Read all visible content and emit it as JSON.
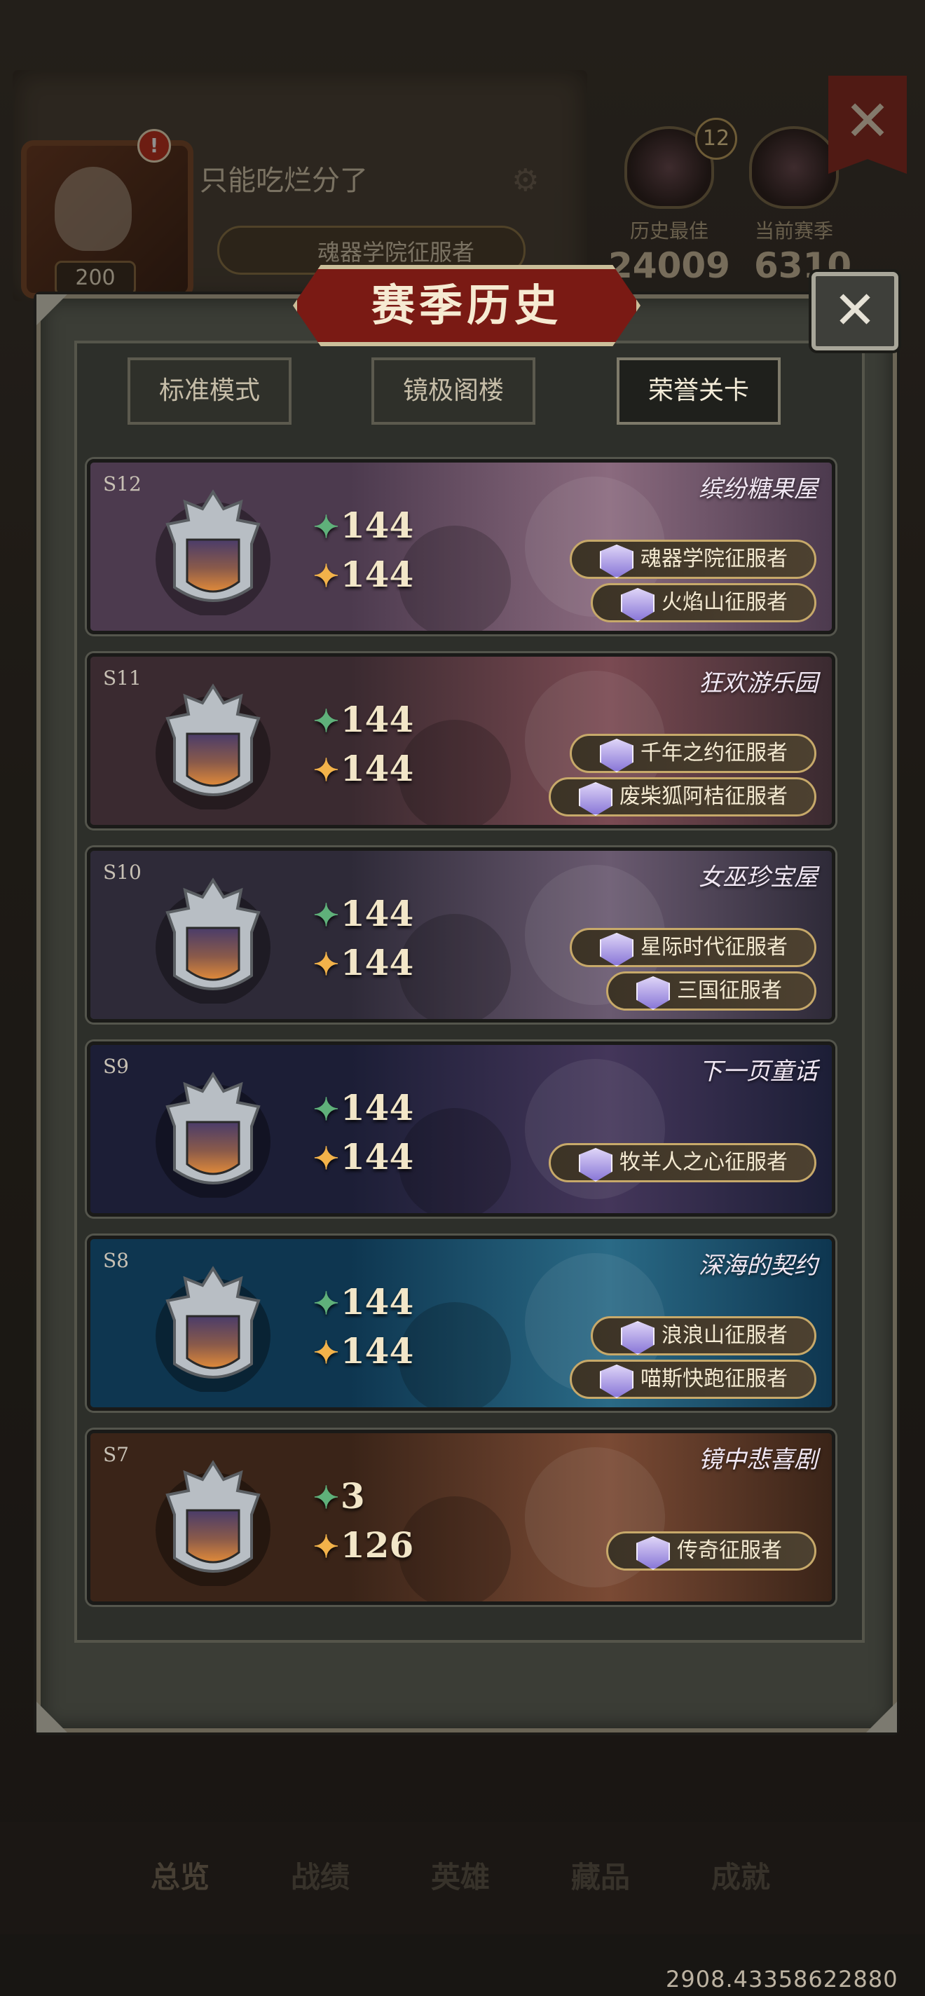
{
  "profile": {
    "player_name": "只能吃烂分了",
    "level": "200",
    "alert_badge": "!",
    "title_badge": "魂器学院征服者",
    "best_label": "历史最佳",
    "current_label": "当前赛季",
    "best_score": "24009",
    "current_score": "6310",
    "rank_badge": "12",
    "close_symbol": "✕"
  },
  "bottom_tabs": [
    "总览",
    "战绩",
    "英雄",
    "藏品",
    "成就"
  ],
  "coord_readout": "2908.43358622880",
  "modal": {
    "title": "赛季历史",
    "close_symbol": "✕",
    "tabs": [
      "标准模式",
      "镜极阁楼",
      "荣誉关卡"
    ],
    "active_tab": "荣誉关卡"
  },
  "seasons": [
    {
      "id": "S12",
      "name": "缤纷糖果屋",
      "green": "144",
      "gold": "144",
      "conquests": [
        "魂器学院征服者",
        "火焰山征服者"
      ],
      "colors": [
        "#4c3a4e",
        "#8a6a7e"
      ]
    },
    {
      "id": "S11",
      "name": "狂欢游乐园",
      "green": "144",
      "gold": "144",
      "conquests": [
        "千年之约征服者",
        "废柴狐阿桔征服者"
      ],
      "colors": [
        "#3a2a30",
        "#7a4a52"
      ]
    },
    {
      "id": "S10",
      "name": "女巫珍宝屋",
      "green": "144",
      "gold": "144",
      "conquests": [
        "星际时代征服者",
        "三国征服者"
      ],
      "colors": [
        "#2e2a38",
        "#6a5a70"
      ]
    },
    {
      "id": "S9",
      "name": "下一页童话",
      "green": "144",
      "gold": "144",
      "conquests": [
        "牧羊人之心征服者"
      ],
      "colors": [
        "#1c1e36",
        "#44365a"
      ]
    },
    {
      "id": "S8",
      "name": "深海的契约",
      "green": "144",
      "gold": "144",
      "conquests": [
        "浪浪山征服者",
        "喵斯快跑征服者"
      ],
      "colors": [
        "#0e3650",
        "#2a6a86"
      ]
    },
    {
      "id": "S7",
      "name": "镜中悲喜剧",
      "green": "3",
      "gold": "126",
      "conquests": [
        "传奇征服者"
      ],
      "colors": [
        "#3a2418",
        "#7a4a34"
      ]
    }
  ],
  "icons": {
    "green_gem": "green-star-gem-icon",
    "gold_gem": "gold-star-gem-icon",
    "shield": "rank-shield-icon",
    "crest": "conquest-crest-icon",
    "gear": "gear-icon"
  }
}
